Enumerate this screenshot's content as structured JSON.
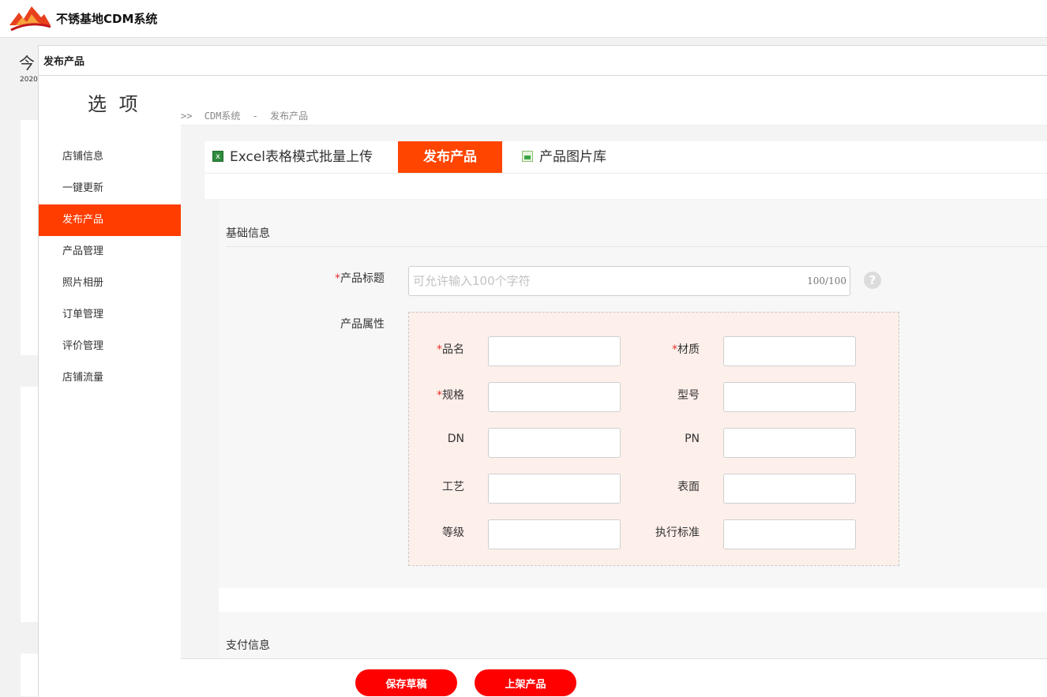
{
  "app": {
    "title": "不锈基地CDM系统"
  },
  "background": {
    "today": "今",
    "year": "2020"
  },
  "dialog": {
    "title": "发布产品"
  },
  "options_heading": "选 项",
  "breadcrumb": {
    "prefix": ">>",
    "root": "CDM系统",
    "separator": "-",
    "current": "发布产品"
  },
  "sidebar": {
    "items": [
      {
        "label": "店铺信息",
        "active": false
      },
      {
        "label": "一键更新",
        "active": false
      },
      {
        "label": "发布产品",
        "active": true
      },
      {
        "label": "产品管理",
        "active": false
      },
      {
        "label": "照片相册",
        "active": false
      },
      {
        "label": "订单管理",
        "active": false
      },
      {
        "label": "评价管理",
        "active": false
      },
      {
        "label": "店铺流量",
        "active": false
      }
    ]
  },
  "tabs": {
    "excel": {
      "label": "Excel表格模式批量上传",
      "icon": "excel-icon"
    },
    "publish": {
      "label": "发布产品"
    },
    "library": {
      "label": "产品图片库",
      "icon": "image-icon"
    }
  },
  "basic_info": {
    "title": "基础信息",
    "required_mark": "*",
    "product_title": {
      "label": "产品标题",
      "placeholder": "可允许输入100个字符",
      "value": "",
      "count": "100/100"
    },
    "help_icon": "?",
    "attributes": {
      "label": "产品属性",
      "fields": [
        {
          "label": "品名",
          "required": "*",
          "value": ""
        },
        {
          "label": "材质",
          "required": "*",
          "value": ""
        },
        {
          "label": "规格",
          "required": "*",
          "value": ""
        },
        {
          "label": "型号",
          "required": "",
          "value": ""
        },
        {
          "label": "DN",
          "required": "",
          "value": ""
        },
        {
          "label": "PN",
          "required": "",
          "value": ""
        },
        {
          "label": "工艺",
          "required": "",
          "value": ""
        },
        {
          "label": "表面",
          "required": "",
          "value": ""
        },
        {
          "label": "等级",
          "required": "",
          "value": ""
        },
        {
          "label": "执行标准",
          "required": "",
          "value": ""
        }
      ]
    }
  },
  "payment_info": {
    "title": "支付信息"
  },
  "footer": {
    "save_draft": "保存草稿",
    "publish": "上架产品"
  },
  "colors": {
    "accent": "#ff4500",
    "sidebar_active": "#ff3d00",
    "button": "#ff0000",
    "attr_bg": "#fdefea",
    "required": "#e5322d"
  }
}
